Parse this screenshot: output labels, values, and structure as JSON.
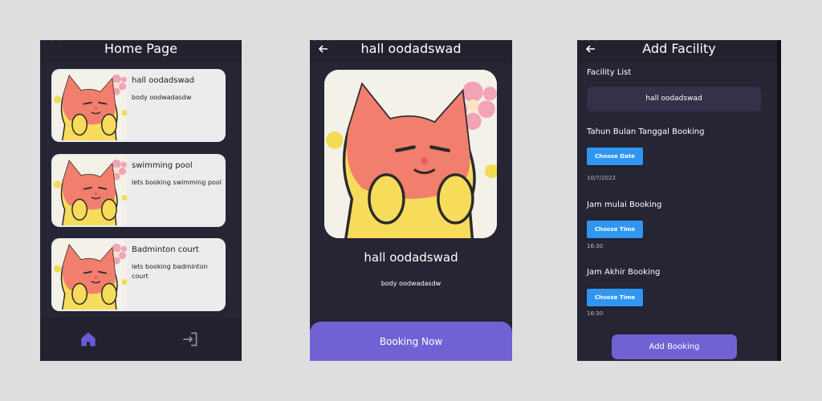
{
  "status_dots": "• • •",
  "home": {
    "title": "Home Page",
    "cards": [
      {
        "title": "hall oodadswad",
        "body": "body oodwadasdw"
      },
      {
        "title": "swimming pool",
        "body": "lets booking swimming pool"
      },
      {
        "title": "Badminton court",
        "body": "lets booking badminton court"
      }
    ],
    "nav": {
      "home_icon": "home-icon",
      "logout_icon": "logout-icon",
      "active_color": "#6a5ad6"
    }
  },
  "detail": {
    "title": "hall oodadswad",
    "body": "body oodwadasdw",
    "booking_button": "Booking Now"
  },
  "facility": {
    "title": "Add Facility",
    "list_label": "Facility List",
    "selected_facility": "hall oodadswad",
    "date_label": "Tahun Bulan Tanggal Booking",
    "date_button": "Choose Date",
    "date_value": "10/7/2022",
    "start_label": "Jam mulai Booking",
    "start_button": "Choose Time",
    "start_value": "16:30",
    "end_label": "Jam Akhir Booking",
    "end_button": "Choose Time",
    "end_value": "16:30",
    "add_button": "Add Booking"
  },
  "colors": {
    "accent": "#7162d4",
    "button_blue": "#2f96f3",
    "background": "#262533"
  }
}
